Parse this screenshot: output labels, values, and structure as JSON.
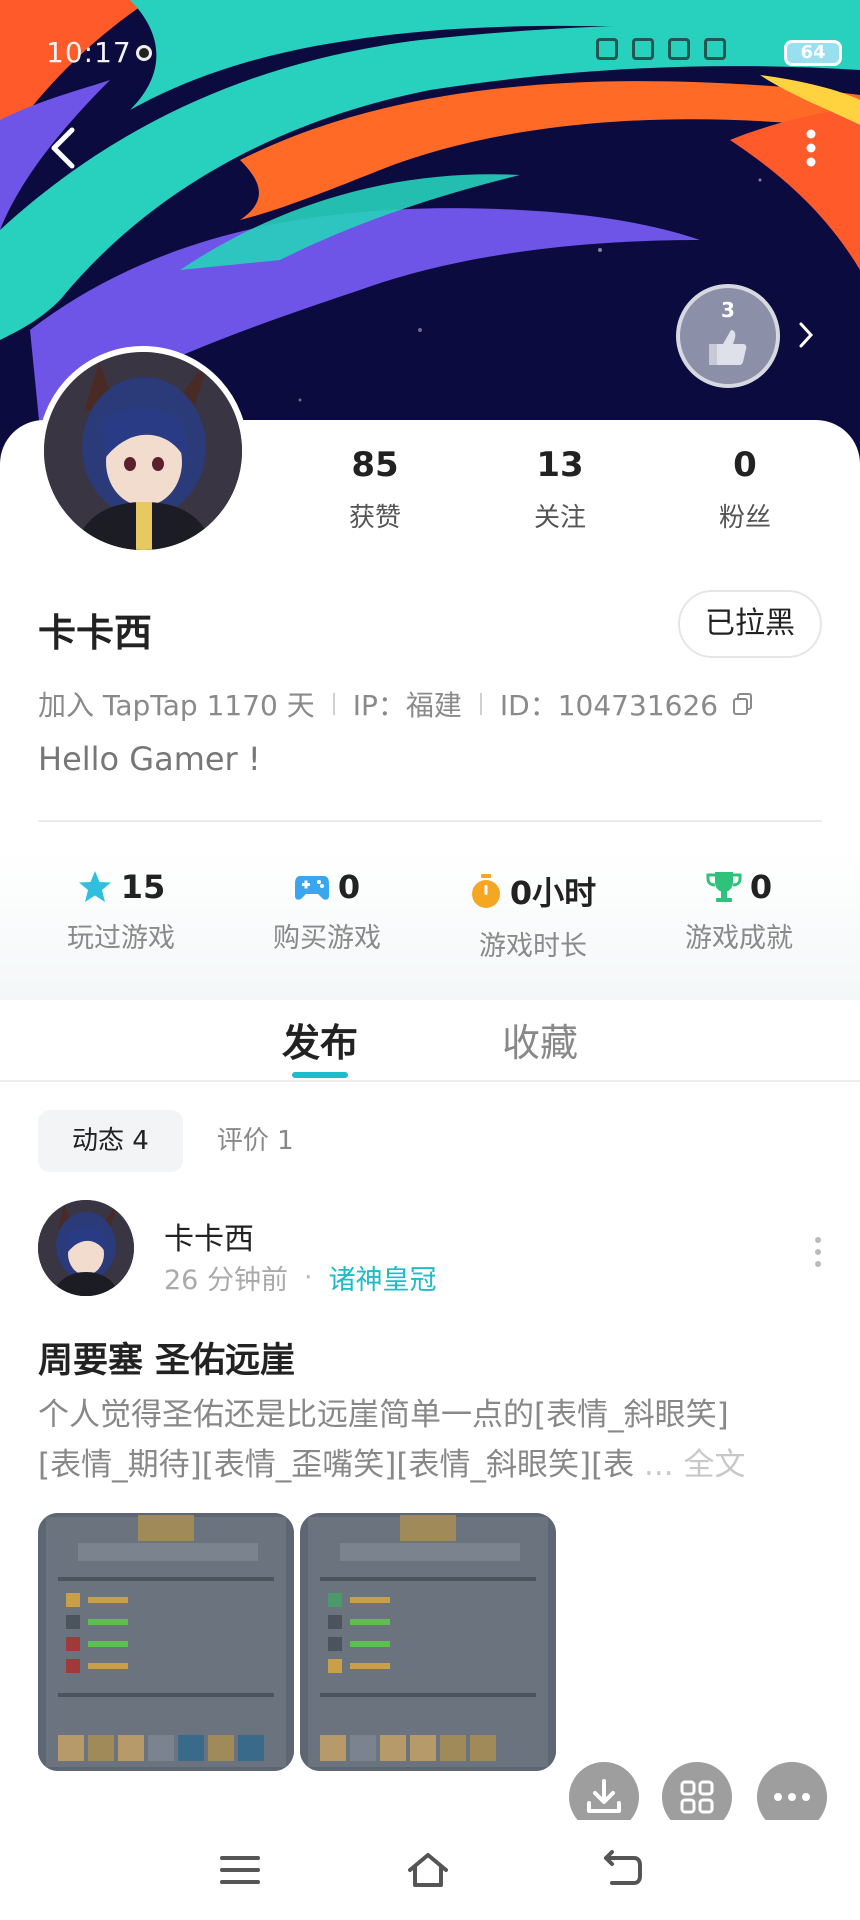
{
  "status_bar": {
    "time": "10:17",
    "battery": "64"
  },
  "badge": {
    "level": "3"
  },
  "profile": {
    "name": "卡卡西",
    "block_label": "已拉黑",
    "joined": "加入 TapTap 1170 天",
    "ip": "IP：福建",
    "id": "ID：104731626",
    "bio": "Hello Gamer !"
  },
  "stats": [
    {
      "value": "85",
      "label": "获赞"
    },
    {
      "value": "13",
      "label": "关注"
    },
    {
      "value": "0",
      "label": "粉丝"
    }
  ],
  "game_stats": [
    {
      "icon": "star-icon",
      "value": "15",
      "label": "玩过游戏",
      "color": "#2fc0e0"
    },
    {
      "icon": "gamepad-icon",
      "value": "0",
      "label": "购买游戏",
      "color": "#3aa6f0"
    },
    {
      "icon": "stopwatch-icon",
      "value": "0小时",
      "label": "游戏时长",
      "color": "#f5a623"
    },
    {
      "icon": "trophy-icon",
      "value": "0",
      "label": "游戏成就",
      "color": "#2fc27a"
    }
  ],
  "tabs": {
    "publish": "发布",
    "favorites": "收藏"
  },
  "subtabs": {
    "moments": "动态 4",
    "reviews": "评价 1"
  },
  "post": {
    "author": "卡卡西",
    "time": "26 分钟前",
    "game": "诸神皇冠",
    "title": "周要塞 圣佑远崖",
    "body_line1": "个人觉得圣佑还是比远崖简单一点的[表情_斜眼笑]",
    "body_line2": "[表情_期待][表情_歪嘴笑][表情_斜眼笑][表",
    "ellipsis": " ... ",
    "full_text": "全文"
  },
  "colors": {
    "accent": "#1ebcc8",
    "banner_bg": "#0c0b3f",
    "fab_bg": "#9e9e9e"
  }
}
